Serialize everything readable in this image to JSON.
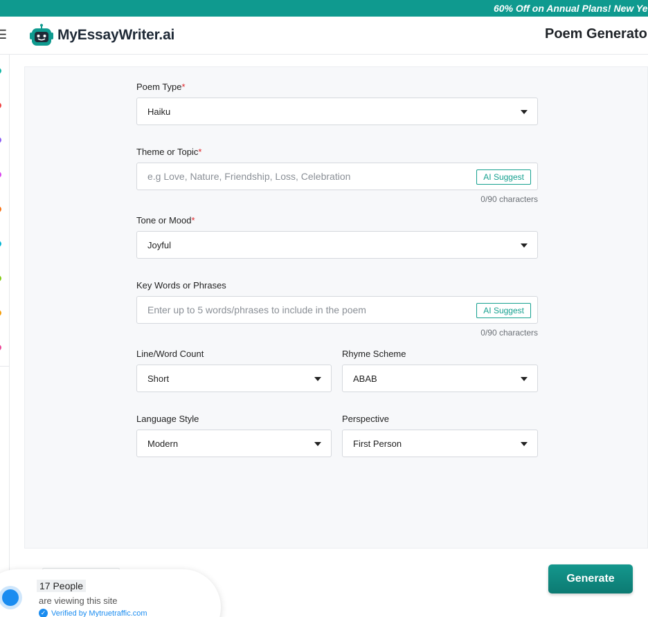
{
  "promo": {
    "text": "60% Off on Annual Plans! New Ye"
  },
  "header": {
    "brand": "MyEssayWriter.ai",
    "page_title": "Poem Generato",
    "logo_icon": "robot-icon",
    "brand_color": "#0f9a8f"
  },
  "form": {
    "poem_type": {
      "label": "Poem Type",
      "required": "*",
      "value": "Haiku"
    },
    "theme": {
      "label": "Theme or Topic",
      "required": "*",
      "placeholder": "e.g Love, Nature, Friendship, Loss, Celebration",
      "ai_suggest": "AI Suggest",
      "count": "0/90 characters"
    },
    "tone": {
      "label": "Tone or Mood",
      "required": "*",
      "value": "Joyful"
    },
    "keywords": {
      "label": "Key Words or Phrases",
      "placeholder": "Enter up to 5 words/phrases to include in the poem",
      "ai_suggest": "AI Suggest",
      "count": "0/90 characters"
    },
    "line_count": {
      "label": "Line/Word Count",
      "value": "Short"
    },
    "rhyme": {
      "label": "Rhyme Scheme",
      "value": "ABAB"
    },
    "language": {
      "label": "Language Style",
      "value": "Modern"
    },
    "perspective": {
      "label": "Perspective",
      "value": "First Person"
    }
  },
  "actions": {
    "generate": "Generate"
  },
  "social_proof": {
    "count": "17 People",
    "text": "are viewing this site",
    "verified": "Verified by Mytruetraffic.com"
  },
  "sidebar_dot_colors": [
    "#14b8a6",
    "#ef4444",
    "#8b5cf6",
    "#d946ef",
    "#f97316",
    "#06b6d4",
    "#84cc16",
    "#f59e0b",
    "#ec4899"
  ]
}
